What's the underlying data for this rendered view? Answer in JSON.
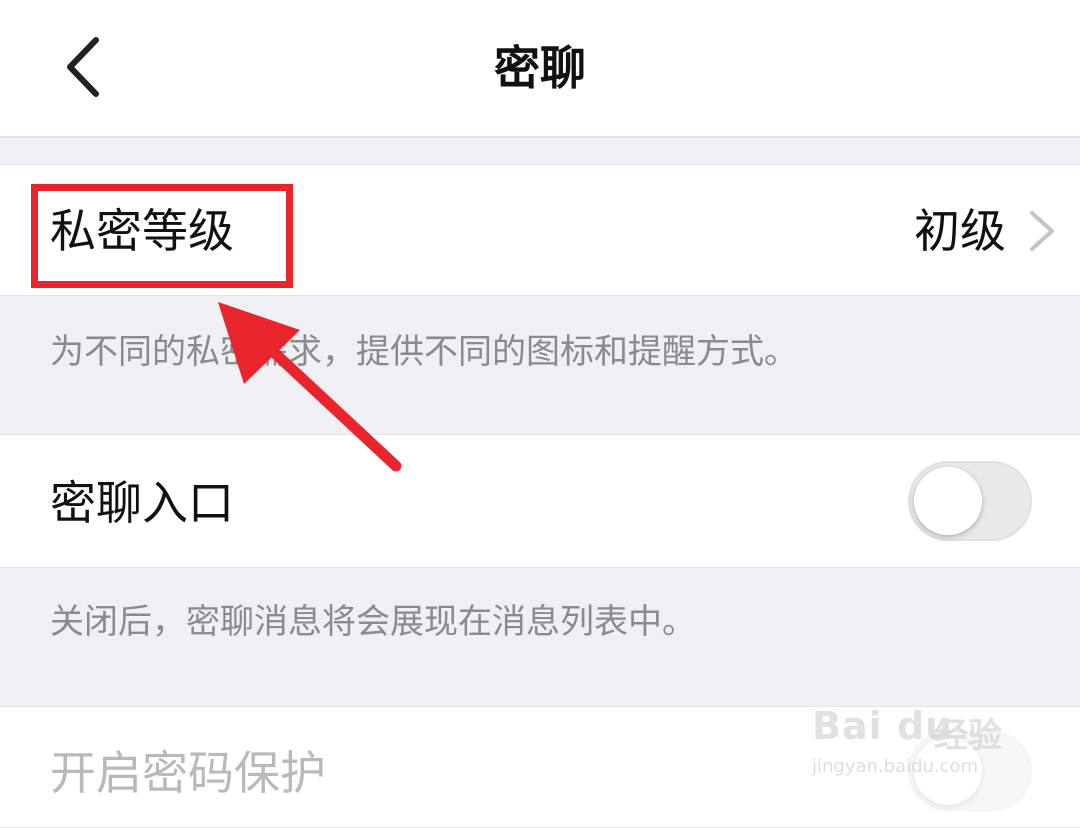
{
  "header": {
    "title": "密聊"
  },
  "sections": {
    "privacy_level": {
      "label": "私密等级",
      "value": "初级",
      "description": "为不同的私密需求，提供不同的图标和提醒方式。"
    },
    "chat_entry": {
      "label": "密聊入口",
      "toggle_on": false,
      "description": "关闭后，密聊消息将会展现在消息列表中。"
    },
    "password_protect": {
      "label": "开启密码保护",
      "toggle_on": false
    }
  },
  "annotation": {
    "color": "#e8242d"
  },
  "watermark": {
    "brand": "Bai du",
    "brand_cn": "经验",
    "url": "jingyan.baidu.com"
  },
  "colors": {
    "background": "#efeff4",
    "text": "#111111",
    "secondary": "#8a8a8f"
  }
}
